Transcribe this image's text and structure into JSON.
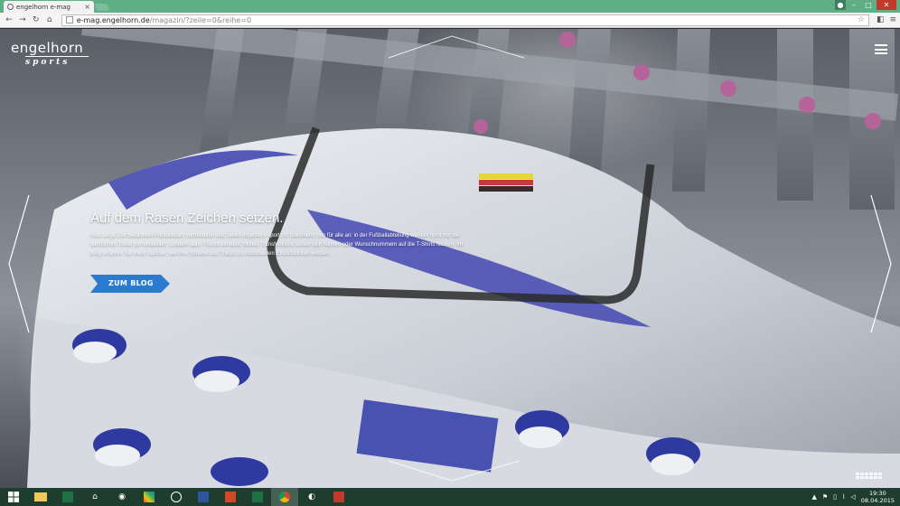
{
  "browser": {
    "tab_title": "engelhorn e-mag",
    "tab_close": "×",
    "url_host": "e-mag.engelhorn.de",
    "url_path": "/magazin/?zeile=0&reihe=0"
  },
  "site": {
    "logo_brand": "engelhorn",
    "logo_sub": "sports"
  },
  "teaser": {
    "headline": "Auf dem Rasen Zeichen setzen.",
    "body": "Was lange Zeit bekannten Fußballstars vorbehalten war, bietet engelhorn sports in Mannheim nun für alle an: in der Fußballabteilung werden nicht nur die sportlichen Treter personalisiert, sondern auch Trikots veredelt. Mittels Transferdruck lassen sich Namen oder Wunschnummern auf die T-Shirts flocken. Im Blog erfahren Sie mehr darüber, wie Ihre Schuhe und Trikots zu individuellen Einzelstücken werden.",
    "cta_label": "ZUM BLOG",
    "cta_color": "#2a7bd0"
  },
  "taskbar": {
    "apps": [
      "explorer",
      "excel",
      "home",
      "camera",
      "paint",
      "hp",
      "word",
      "powerpoint",
      "excel-2",
      "chrome",
      "media",
      "acrobat"
    ],
    "clock_time": "19:30",
    "clock_date": "08.04.2015"
  },
  "colors": {
    "titlebar": "#5fae86",
    "taskbar": "#1f3d2f",
    "accent_blue": "#2a7bd0"
  }
}
